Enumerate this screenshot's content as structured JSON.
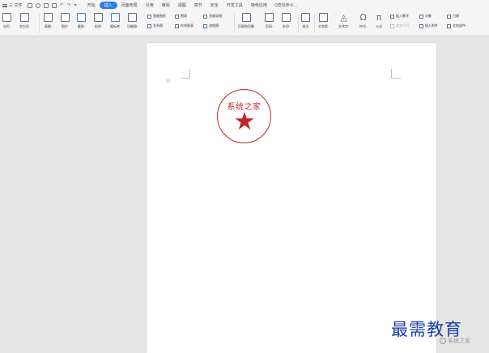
{
  "menubar": {
    "file_label": "三 文件",
    "tabs": [
      "开始",
      "插入",
      "页面布局",
      "引用",
      "审阅",
      "视图",
      "章节",
      "安全",
      "开发工具",
      "特色应用"
    ],
    "active_tab": "插入",
    "search_label": "Q查找命令..."
  },
  "ribbon": {
    "big_buttons": [
      {
        "label": "分页·"
      },
      {
        "label": "空白页·"
      },
      {
        "label": "表格·"
      },
      {
        "label": "图片·"
      },
      {
        "label": "截屏·"
      },
      {
        "label": "形状·"
      },
      {
        "label": "图标库"
      },
      {
        "label": "功能图·"
      },
      {
        "label": "页眉和页脚"
      },
      {
        "label": "页码·"
      },
      {
        "label": "水印·"
      },
      {
        "label": "批注"
      },
      {
        "label": "文本框·"
      },
      {
        "label": "艺术字·"
      },
      {
        "label": "符号·"
      },
      {
        "label": "公式"
      }
    ],
    "small_buttons": [
      {
        "label": "智能图形"
      },
      {
        "label": "图表"
      },
      {
        "label": "思维导图·"
      },
      {
        "label": "关系图"
      },
      {
        "label": "在线图表"
      },
      {
        "label": "流程图·"
      },
      {
        "label": "插入数字"
      },
      {
        "label": "对象·"
      },
      {
        "label": "日期"
      },
      {
        "label": "首字下沉"
      },
      {
        "label": "插入附件"
      },
      {
        "label": "文档部件·"
      }
    ]
  },
  "document": {
    "stamp_text": "系统之家"
  },
  "watermark": {
    "main": "最需教育",
    "sub": "系统之家"
  },
  "colors": {
    "stamp_red": "#c0262d",
    "accent_blue": "#2b7de9",
    "watermark_blue": "#1a3fa8"
  }
}
